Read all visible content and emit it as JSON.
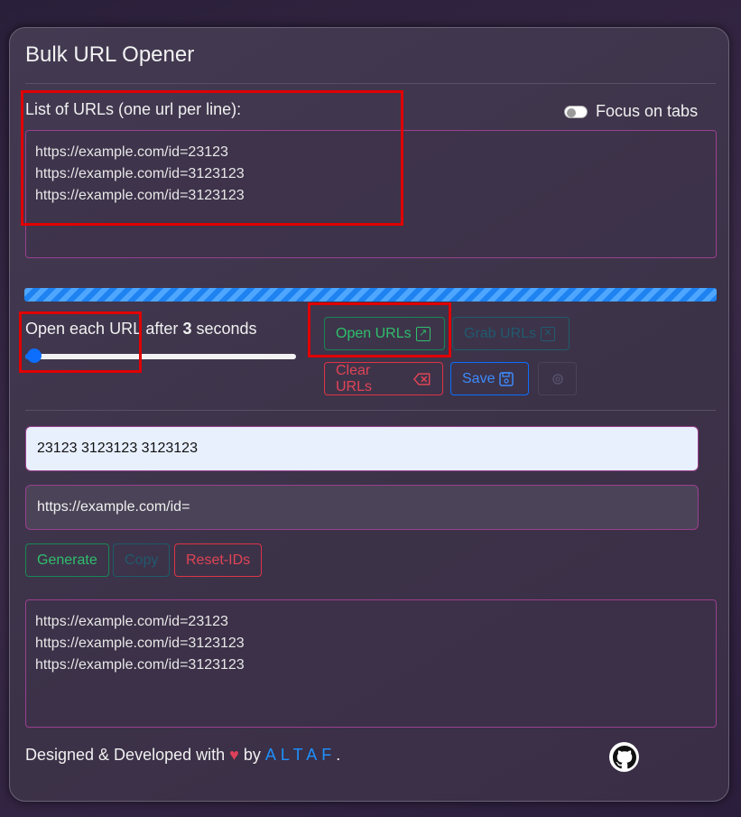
{
  "app": {
    "title": "Bulk URL Opener"
  },
  "url_list": {
    "label": "List of URLs (one url per line):",
    "lines": "https://example.com/id=23123\nhttps://example.com/id=3123123\nhttps://example.com/id=3123123"
  },
  "focus_toggle": {
    "label": "Focus on tabs",
    "checked": false
  },
  "progress": {
    "value": 1.0,
    "color": "#1e82f0"
  },
  "delay": {
    "prefix": "Open each URL after ",
    "value": "3",
    "suffix": " seconds",
    "slider_fraction": 0.0
  },
  "buttons": {
    "open_urls": "Open URLs",
    "grab_urls": "Grab URLs",
    "clear_urls": "Clear URLs",
    "save": "Save"
  },
  "generator": {
    "ids_value": "23123 3123123 3123123",
    "base_url_value": "https://example.com/id=",
    "generate": "Generate",
    "copy": "Copy",
    "reset_ids": "Reset-IDs",
    "output": "https://example.com/id=23123\nhttps://example.com/id=3123123\nhttps://example.com/id=3123123"
  },
  "footer": {
    "text": "Designed & Developed with",
    "heart": "♥",
    "by": "by",
    "author": "ALTAF",
    "period": ".",
    "github_icon": "github-icon"
  },
  "colors": {
    "accent_border": "#9b3f8f",
    "highlight": "#e00000"
  }
}
